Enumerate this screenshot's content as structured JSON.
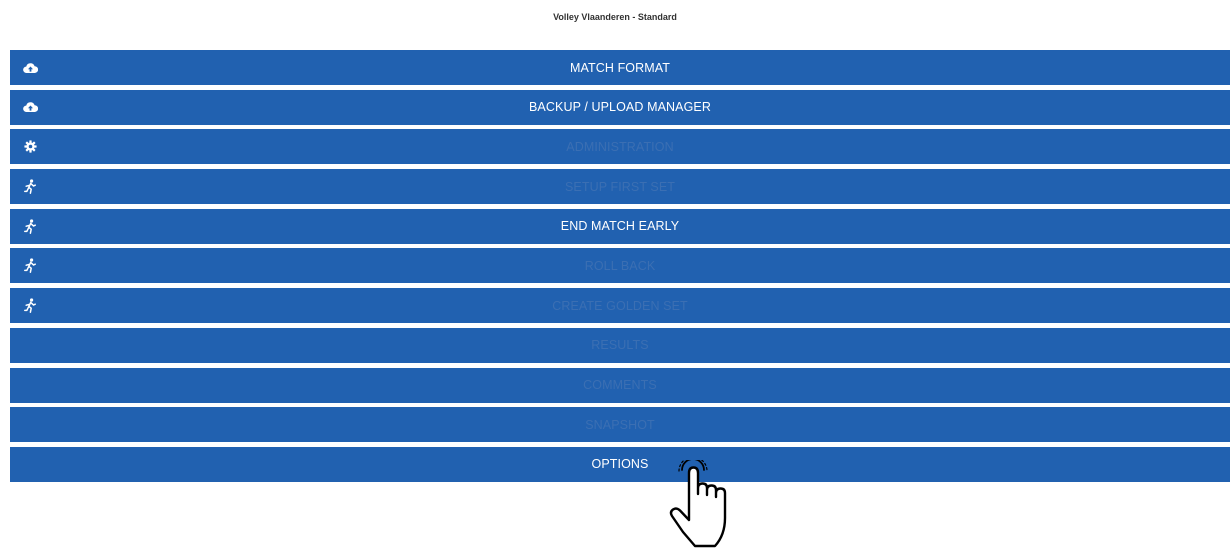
{
  "header": {
    "title": "Volley Vlaanderen - Standard"
  },
  "menu": {
    "items": [
      {
        "label": "MATCH FORMAT",
        "icon": "cloud-upload-icon",
        "enabled": true
      },
      {
        "label": "BACKUP / UPLOAD MANAGER",
        "icon": "cloud-upload-icon",
        "enabled": true
      },
      {
        "label": "ADMINISTRATION",
        "icon": "gear-icon",
        "enabled": false
      },
      {
        "label": "SETUP FIRST SET",
        "icon": "running-person-icon",
        "enabled": false
      },
      {
        "label": "END MATCH EARLY",
        "icon": "running-person-icon",
        "enabled": true
      },
      {
        "label": "ROLL BACK",
        "icon": "running-person-icon",
        "enabled": false
      },
      {
        "label": "CREATE GOLDEN SET",
        "icon": "running-person-icon",
        "enabled": false
      },
      {
        "label": "RESULTS",
        "icon": "",
        "enabled": false
      },
      {
        "label": "COMMENTS",
        "icon": "",
        "enabled": false
      },
      {
        "label": "SNAPSHOT",
        "icon": "",
        "enabled": false
      },
      {
        "label": "OPTIONS",
        "icon": "",
        "enabled": true
      }
    ]
  },
  "colors": {
    "bar": "#2161b0",
    "enabled_text": "#ffffff",
    "disabled_text": "#3b6fb3"
  },
  "cursor": {
    "icon": "pointing-hand-icon"
  }
}
